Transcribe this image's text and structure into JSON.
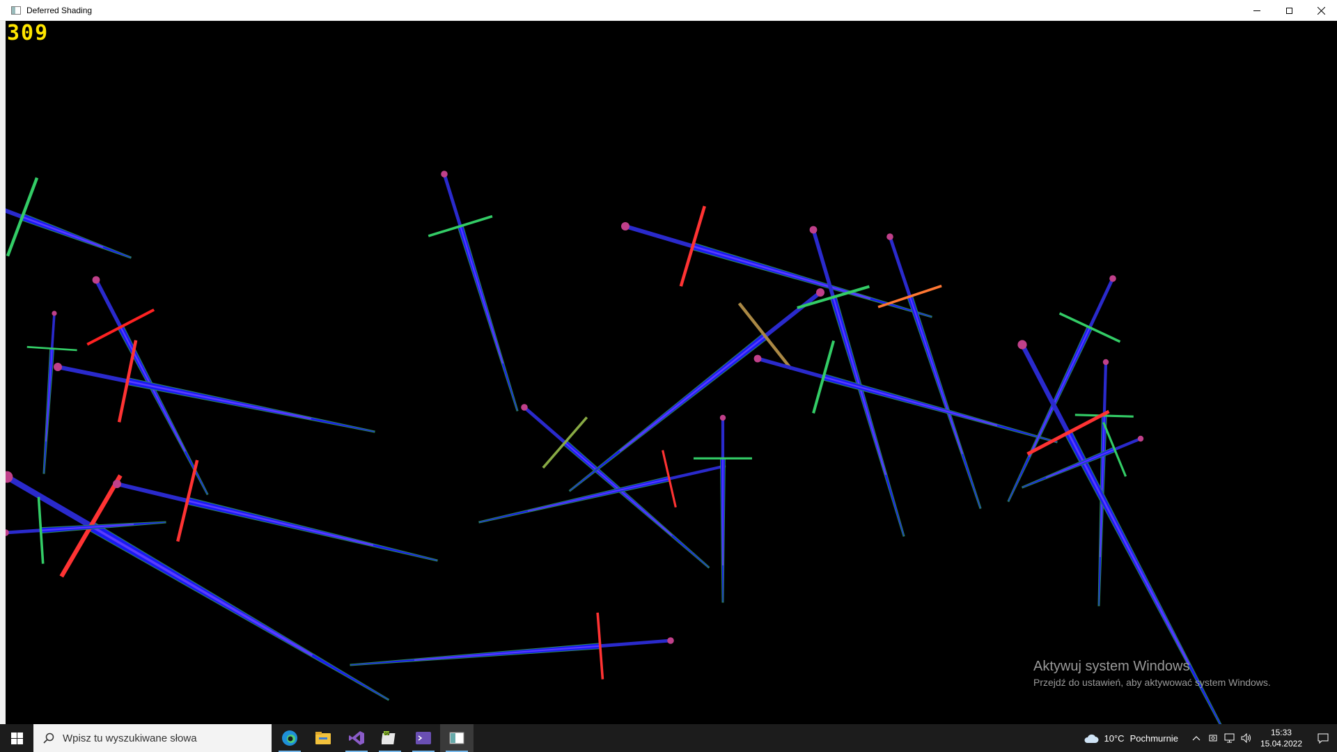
{
  "window": {
    "title": "Deferred Shading",
    "controls": [
      "minimize",
      "maximize",
      "close"
    ]
  },
  "viewport": {
    "fps_counter": "309",
    "scene": "deferred-shading-normals-sword-instances"
  },
  "watermark": {
    "title": "Aktywuj system Windows",
    "subtitle": "Przejdź do ustawień, aby aktywować system Windows."
  },
  "taskbar": {
    "search_placeholder": "Wpisz tu wyszukiwane słowa",
    "apps": [
      "edge-icon",
      "file-explorer-icon",
      "visual-studio-icon",
      "notepad-plus-icon",
      "terminal-icon",
      "deferred-shading-app-icon"
    ],
    "weather": {
      "temperature": "10°C",
      "condition": "Pochmurnie"
    },
    "clock": {
      "time": "15:33",
      "date": "15.04.2022"
    }
  }
}
